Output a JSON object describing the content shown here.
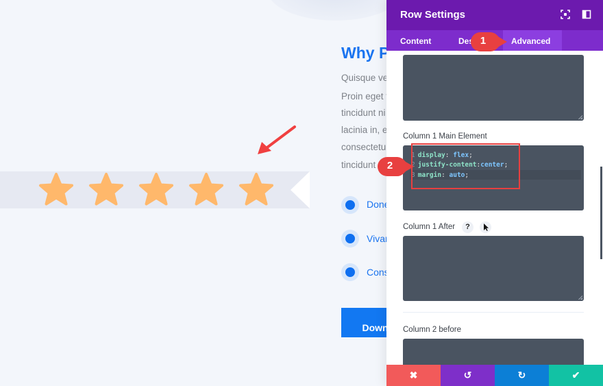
{
  "page": {
    "heading": "Why P",
    "paragraph_lines": [
      "Quisque ve",
      "Proin eget t",
      "tincidunt ni",
      "lacinia in, e",
      "consectetu",
      "tincidunt"
    ],
    "bullets": [
      "Done",
      "Vivar",
      "Cons"
    ],
    "download_label": "Downl",
    "rating": {
      "value": 5,
      "max": 5
    },
    "colors": {
      "accent": "#1a74f0",
      "star": "#ffb86b",
      "ribbon": "#e6e9f2"
    }
  },
  "panel": {
    "title": "Row Settings",
    "header_icons": [
      "expand-icon",
      "split-view-icon"
    ],
    "tabs": [
      {
        "label": "Content",
        "active": false
      },
      {
        "label": "Design",
        "visible_label": "Des",
        "active": false
      },
      {
        "label": "Advanced",
        "active": true
      }
    ],
    "fields": [
      {
        "label": "",
        "code": []
      },
      {
        "label": "Column 1 Main Element",
        "code": [
          {
            "n": "1",
            "prop": "display",
            "sep": ": ",
            "val": "flex",
            "end": ";"
          },
          {
            "n": "2",
            "prop": "justify-content",
            "sep": ":",
            "val": "center",
            "end": ";"
          },
          {
            "n": "3",
            "prop": "margin",
            "sep": ": ",
            "val": "auto",
            "end": ";"
          }
        ]
      },
      {
        "label": "Column 1 After",
        "help": "?",
        "code": []
      },
      {
        "label": "Column 2 before",
        "code": []
      }
    ],
    "footer": [
      {
        "name": "cancel",
        "glyph": "✖",
        "color": "#f25a5a"
      },
      {
        "name": "undo",
        "glyph": "↺",
        "color": "#7e2fc9"
      },
      {
        "name": "redo",
        "glyph": "↻",
        "color": "#0c7fd6"
      },
      {
        "name": "save",
        "glyph": "✔",
        "color": "#12c2a4"
      }
    ],
    "colors": {
      "header": "#6c1aae",
      "tabs": "#7d2ccc",
      "active_tab": "#8c3ee0",
      "codebox": "#4a5461"
    }
  },
  "annotations": {
    "step1": "1",
    "step2": "2",
    "color": "#e84040"
  }
}
